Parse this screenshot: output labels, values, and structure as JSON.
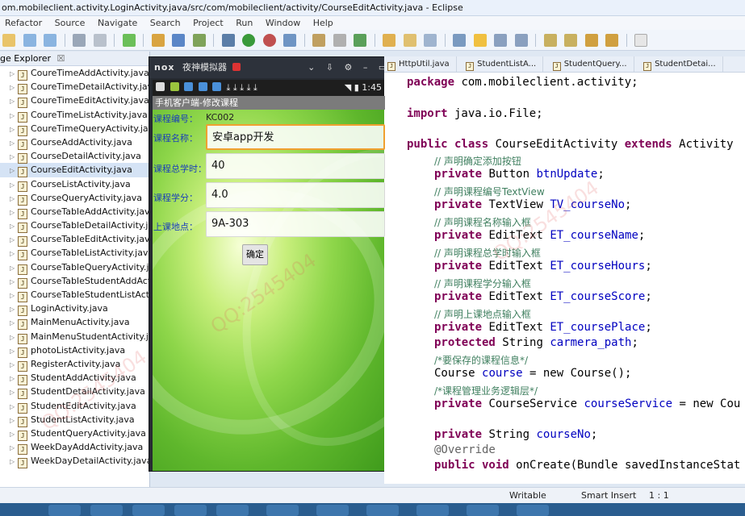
{
  "window": {
    "title": "om.mobileclient.activity.LoginActivity.java/src/com/mobileclient/activity/CourseEditActivity.java - Eclipse"
  },
  "menu": [
    "Refactor",
    "Source",
    "Navigate",
    "Search",
    "Project",
    "Run",
    "Window",
    "Help"
  ],
  "explorer": {
    "tab_label": "ge Explorer",
    "tab_close": "☒",
    "files": [
      "CoureTimeAddActivity.java",
      "CoureTimeDetailActivity.java",
      "CoureTimeEditActivity.java",
      "CoureTimeListActivity.java",
      "CoureTimeQueryActivity.java",
      "CourseAddActivity.java",
      "CourseDetailActivity.java",
      "CourseEditActivity.java",
      "CourseListActivity.java",
      "CourseQueryActivity.java",
      "CourseTableAddActivity.java",
      "CourseTableDetailActivity.java",
      "CourseTableEditActivity.java",
      "CourseTableListActivity.java",
      "CourseTableQueryActivity.java",
      "CourseTableStudentAddActi",
      "CourseTableStudentListActivi",
      "LoginActivity.java",
      "MainMenuActivity.java",
      "MainMenuStudentActivity.java",
      "photoListActivity.java",
      "RegisterActivity.java",
      "StudentAddActivity.java",
      "StudentDetailActivity.java",
      "StudentEditActivity.java",
      "StudentListActivity.java",
      "StudentQueryActivity.java",
      "WeekDayAddActivity.java",
      "WeekDayDetailActivity.java"
    ],
    "selected_index": 7
  },
  "emulator": {
    "logo": "nox",
    "title": "夜神模拟器",
    "time": "1:45",
    "app_title": "手机客户端-修改课程",
    "course_no_label": "课程编号：",
    "course_no_value": "KC002",
    "course_name_label": "课程名称：",
    "course_name_value": "安卓app开发",
    "course_hours_label": "课程总学时：",
    "course_hours_value": "40",
    "course_score_label": "课程学分：",
    "course_score_value": "4.0",
    "course_place_label": "上课地点：",
    "course_place_value": "9A-303",
    "ok_button": "确定"
  },
  "tabs": [
    "HttpUtil.java",
    "StudentListA...",
    "StudentQuery...",
    "StudentDetai..."
  ],
  "code": {
    "l1_kw": "package",
    "l1_rest": " com.mobileclient.activity;",
    "l2_kw": "import",
    "l2_rest": " java.io.File;",
    "l3_kw1": "public class",
    "l3_name": " CourseEditActivity ",
    "l3_kw2": "extends",
    "l3_rest": " Activity",
    "c1": "// 声明确定添加按钮",
    "f1_type": "Button",
    "f1_name": "btnUpdate",
    "c2": "// 声明课程编号TextView",
    "f2_type": "TextView",
    "f2_name": "TV_courseNo",
    "c3": "// 声明课程名称输入框",
    "f3_type": "EditText",
    "f3_name": "ET_courseName",
    "c4": "// 声明课程总学时输入框",
    "f4_type": "EditText",
    "f4_name": "ET_courseHours",
    "c5": "// 声明课程学分输入框",
    "f5_type": "EditText",
    "f5_name": "ET_courseScore",
    "c6": "// 声明上课地点输入框",
    "f6_type": "EditText",
    "f6_name": "ET_coursePlace",
    "kw_private": "private",
    "kw_protected": "protected",
    "f7_type": "String",
    "f7_name": "carmera_path",
    "c7": "/*要保存的课程信息*/",
    "f8_type": "Course",
    "f8_name": "course",
    "f8_rest": " = new Course();",
    "c8": "/*课程管理业务逻辑层*/",
    "f9_type": "CourseService",
    "f9_name": "courseService",
    "f9_rest": " = new Cou",
    "f10_type": "String",
    "f10_name": "courseNo",
    "annotation": "@Override",
    "last_kw": "public void",
    "last_rest": " onCreate(Bundle savedInstanceStat"
  },
  "status": {
    "writable": "Writable",
    "insert_mode": "Smart Insert",
    "position": "1 : 1"
  },
  "watermark": "QQ:2545404",
  "colors": {
    "keyword": "#7f0055",
    "comment": "#3f7f5f",
    "field": "#0000c0",
    "label": "#1a3fb8",
    "focus": "#f0a030"
  }
}
